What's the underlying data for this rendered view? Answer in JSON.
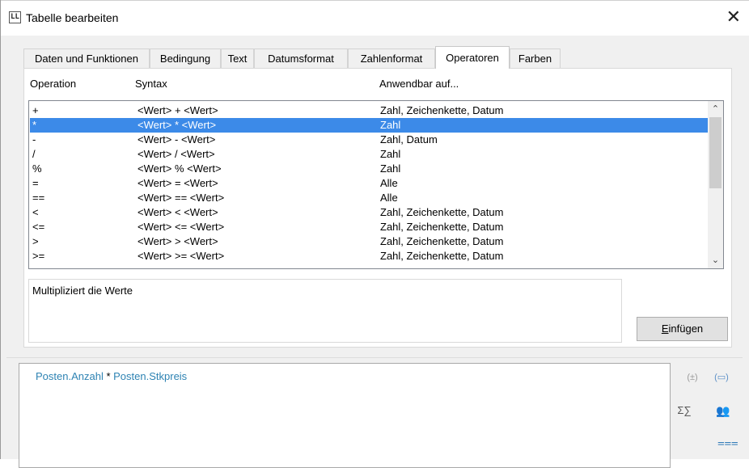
{
  "window": {
    "app_icon_text": "LL",
    "title": "Tabelle bearbeiten",
    "close_glyph": "✕"
  },
  "tabs": [
    {
      "label": "Daten und Funktionen",
      "active": false
    },
    {
      "label": "Bedingung",
      "active": false
    },
    {
      "label": "Text",
      "active": false
    },
    {
      "label": "Datumsformat",
      "active": false
    },
    {
      "label": "Zahlenformat",
      "active": false
    },
    {
      "label": "Operatoren",
      "active": true
    },
    {
      "label": "Farben",
      "active": false
    }
  ],
  "operators_table": {
    "headers": {
      "operation": "Operation",
      "syntax": "Syntax",
      "applicable": "Anwendbar auf..."
    },
    "selected_index": 1,
    "rows": [
      {
        "operation": "+",
        "syntax": "<Wert> + <Wert>",
        "applicable": "Zahl, Zeichenkette, Datum"
      },
      {
        "operation": "*",
        "syntax": "<Wert> * <Wert>",
        "applicable": "Zahl"
      },
      {
        "operation": "-",
        "syntax": "<Wert> - <Wert>",
        "applicable": "Zahl, Datum"
      },
      {
        "operation": "/",
        "syntax": "<Wert> / <Wert>",
        "applicable": "Zahl"
      },
      {
        "operation": "%",
        "syntax": "<Wert> % <Wert>",
        "applicable": "Zahl"
      },
      {
        "operation": "=",
        "syntax": "<Wert> = <Wert>",
        "applicable": "Alle"
      },
      {
        "operation": "==",
        "syntax": "<Wert> == <Wert>",
        "applicable": "Alle"
      },
      {
        "operation": "<",
        "syntax": "<Wert> < <Wert>",
        "applicable": "Zahl, Zeichenkette, Datum"
      },
      {
        "operation": "<=",
        "syntax": "<Wert> <= <Wert>",
        "applicable": "Zahl, Zeichenkette, Datum"
      },
      {
        "operation": ">",
        "syntax": "<Wert> > <Wert>",
        "applicable": "Zahl, Zeichenkette, Datum"
      },
      {
        "operation": ">=",
        "syntax": "<Wert> >= <Wert>",
        "applicable": "Zahl, Zeichenkette, Datum"
      }
    ]
  },
  "description": "Multipliziert die Werte",
  "insert_button": {
    "prefix": "E",
    "rest": "infügen"
  },
  "formula": {
    "field1": "Posten.Anzahl",
    "operator": " * ",
    "field2": "Posten.Stkpreis"
  },
  "side_icons": {
    "paren": "(±)",
    "strparen": "(▭)",
    "sigma": "Σ∑",
    "users": "👥",
    "func": "⩶"
  },
  "colors": {
    "selection": "#3c8ae8",
    "field_text": "#2e83b3"
  }
}
